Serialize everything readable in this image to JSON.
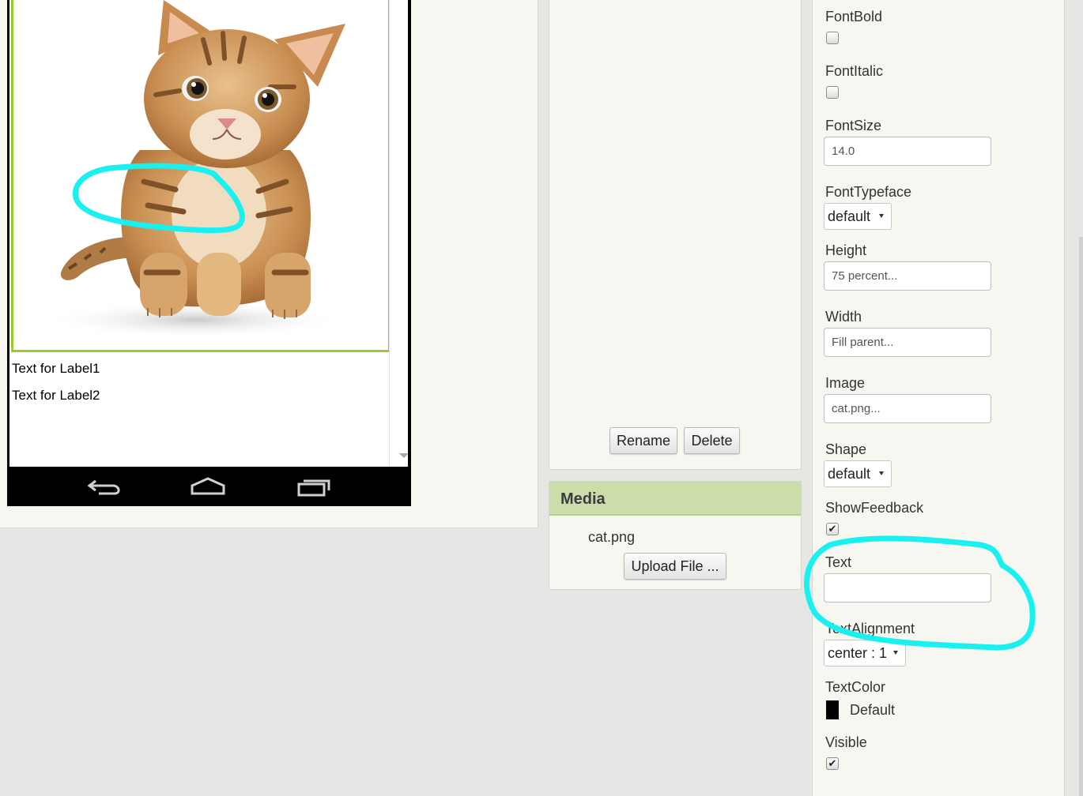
{
  "viewer": {
    "label1": "Text for Label1",
    "label2": "Text for Label2"
  },
  "components": {
    "rename_label": "Rename",
    "delete_label": "Delete"
  },
  "media": {
    "title": "Media",
    "files": [
      "cat.png"
    ],
    "upload_label": "Upload File ..."
  },
  "properties": {
    "font_bold": {
      "label": "FontBold",
      "checked": false
    },
    "font_italic": {
      "label": "FontItalic",
      "checked": false
    },
    "font_size": {
      "label": "FontSize",
      "value": "14.0"
    },
    "font_typeface": {
      "label": "FontTypeface",
      "value": "default"
    },
    "height": {
      "label": "Height",
      "value": "75 percent..."
    },
    "width": {
      "label": "Width",
      "value": "Fill parent..."
    },
    "image": {
      "label": "Image",
      "value": "cat.png..."
    },
    "shape": {
      "label": "Shape",
      "value": "default"
    },
    "show_feedback": {
      "label": "ShowFeedback",
      "checked": true
    },
    "text": {
      "label": "Text",
      "value": ""
    },
    "text_alignment": {
      "label": "TextAlignment",
      "value": "center : 1"
    },
    "text_color": {
      "label": "TextColor",
      "value": "Default",
      "color": "#000000"
    },
    "visible": {
      "label": "Visible",
      "checked": true
    }
  },
  "colors": {
    "accent_green": "#9cc832",
    "media_header": "#cbddaa",
    "annotation": "#19f0f0"
  }
}
